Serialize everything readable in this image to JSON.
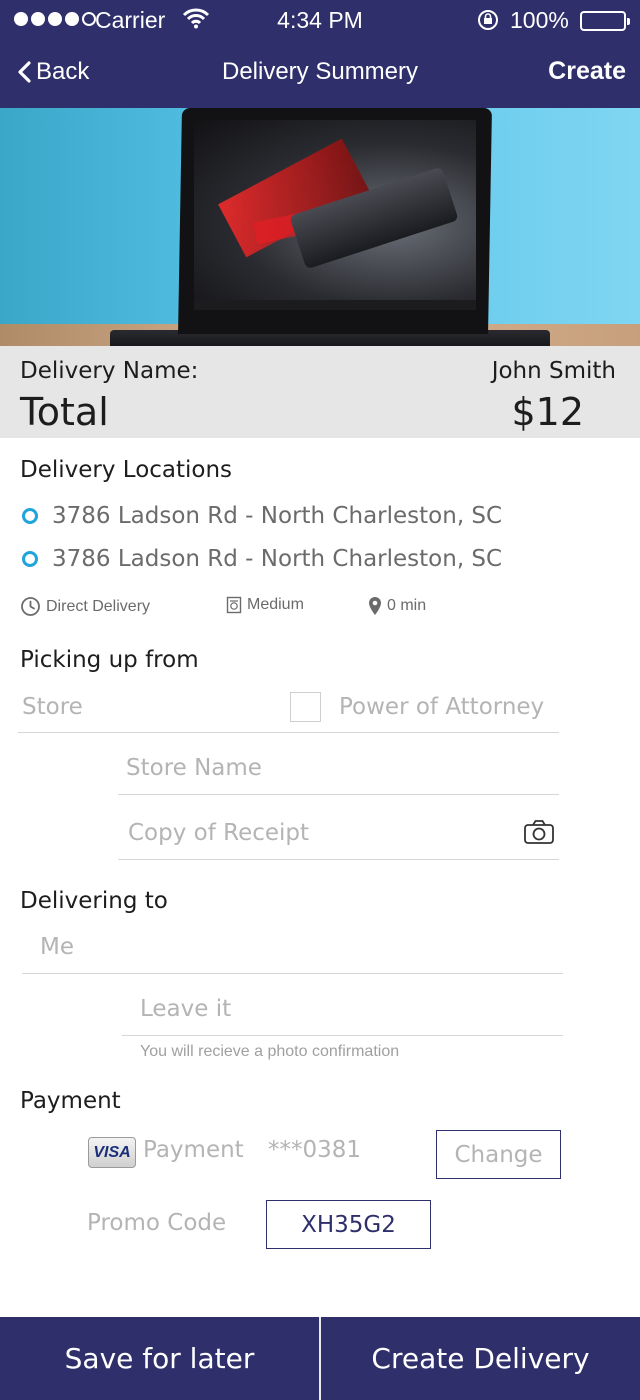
{
  "status_bar": {
    "carrier": "Carrier",
    "time": "4:34 PM",
    "battery": "100%"
  },
  "nav": {
    "back_label": "Back",
    "title": "Delivery Summery",
    "create_label": "Create"
  },
  "summary": {
    "delivery_name_label": "Delivery Name:",
    "delivery_name_value": "John Smith",
    "total_label": "Total",
    "total_value": "$12"
  },
  "locations": {
    "title": "Delivery Locations",
    "items": [
      "3786 Ladson Rd - North Charleston, SC",
      "3786 Ladson Rd - North Charleston, SC"
    ],
    "meta": {
      "delivery_type": "Direct Delivery",
      "size": "Medium",
      "time": "0 min"
    }
  },
  "pickup": {
    "title": "Picking up from",
    "store_placeholder": "Store",
    "power_of_attorney_label": "Power of Attorney",
    "store_name_placeholder": "Store Name",
    "receipt_placeholder": "Copy of Receipt"
  },
  "delivering": {
    "title": "Delivering to",
    "recipient_placeholder": "Me",
    "leave_placeholder": "Leave it",
    "hint": "You will recieve a photo confirmation"
  },
  "payment": {
    "title": "Payment",
    "card_brand": "VISA",
    "payment_label": "Payment",
    "card_number": "***0381",
    "change_label": "Change",
    "promo_label": "Promo Code",
    "promo_value": "XH35G2"
  },
  "footer": {
    "save_label": "Save for later",
    "create_label": "Create Delivery"
  },
  "colors": {
    "brand": "#2f2f6b",
    "accent": "#20a4dc",
    "summary_bg": "#e6e6e6"
  }
}
